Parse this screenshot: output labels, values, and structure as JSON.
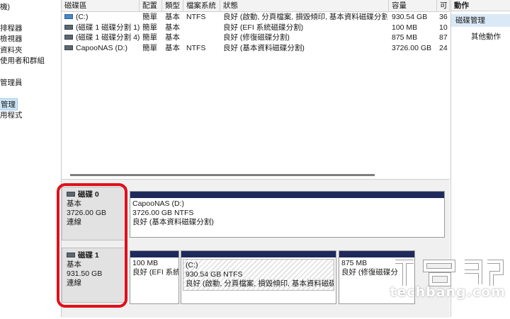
{
  "tree": {
    "items": [
      {
        "label": "機)"
      },
      {
        "label": "排程器"
      },
      {
        "label": "檢視器"
      },
      {
        "label": "資料夾"
      },
      {
        "label": "使用者和群組"
      },
      {
        "label": "管理員"
      },
      {
        "label": "管理"
      },
      {
        "label": "用程式"
      }
    ]
  },
  "volumes": {
    "headers": [
      "磁碟區",
      "配置",
      "類型",
      "檔案系統",
      "狀態",
      "容量",
      "可"
    ],
    "rows": [
      {
        "name": "(C:)",
        "layout": "簡單",
        "type": "基本",
        "fs": "NTFS",
        "status": "良好 (啟動, 分頁檔案, 損毀傾印, 基本資料磁碟分割)",
        "capacity": "930.54 GB",
        "free": "36",
        "icon": "drive-icon"
      },
      {
        "name": "(磁碟 1 磁碟分割 1)",
        "layout": "簡單",
        "type": "基本",
        "fs": "",
        "status": "良好 (EFI 系統磁碟分割)",
        "capacity": "100 MB",
        "free": "10",
        "icon": "drive-icon"
      },
      {
        "name": "(磁碟 1 磁碟分割 4)",
        "layout": "簡單",
        "type": "基本",
        "fs": "",
        "status": "良好 (修復磁碟分割)",
        "capacity": "875 MB",
        "free": "87",
        "icon": "drive-icon"
      },
      {
        "name": "CapooNAS (D:)",
        "layout": "簡單",
        "type": "基本",
        "fs": "NTFS",
        "status": "良好 (基本資料磁碟分割)",
        "capacity": "3726.00 GB",
        "free": "24",
        "icon": "drive-icon"
      }
    ]
  },
  "disks": [
    {
      "name": "磁碟 0",
      "type": "基本",
      "size": "3726.00 GB",
      "state": "連線",
      "partitions": [
        {
          "title": "CapooNAS  (D:)",
          "size": "3726.00 GB NTFS",
          "status": "良好 (基本資料磁碟分割)"
        }
      ]
    },
    {
      "name": "磁碟 1",
      "type": "基本",
      "size": "931.50 GB",
      "state": "連線",
      "partitions": [
        {
          "title": "",
          "size": "100 MB",
          "status": "良好 (EFI 系統"
        },
        {
          "title": "(C:)",
          "size": "930.54 GB NTFS",
          "status": "良好 (啟動, 分頁檔案, 損毀傾印, 基本資料磁碟分"
        },
        {
          "title": "",
          "size": "875 MB",
          "status": "良好 (修復磁碟分"
        }
      ]
    }
  ],
  "actions": {
    "title": "動作",
    "section": "磁碟管理",
    "more": "其他動作"
  },
  "watermark": {
    "text": "techbang.com"
  },
  "colors": {
    "partition_bar": "#1f2a5c",
    "highlight": "#e0101a",
    "selected": "#cde6f7"
  }
}
